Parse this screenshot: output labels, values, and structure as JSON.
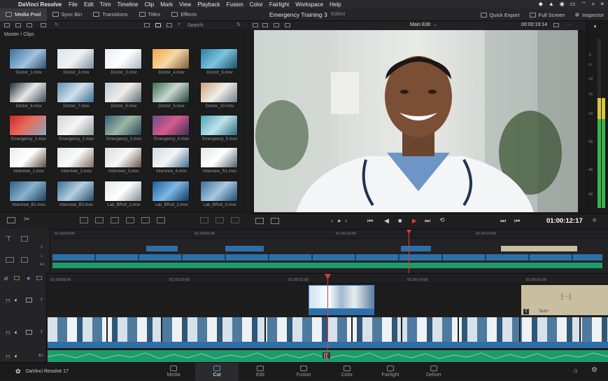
{
  "menubar": {
    "app": "DaVinci Resolve",
    "items": [
      "File",
      "Edit",
      "Trim",
      "Timeline",
      "Clip",
      "Mark",
      "View",
      "Playback",
      "Fusion",
      "Color",
      "Fairlight",
      "Workspace",
      "Help"
    ]
  },
  "toolbar": {
    "media_pool": "Media Pool",
    "sync_bin": "Sync Bin",
    "transitions": "Transitions",
    "titles": "Titles",
    "effects": "Effects",
    "project_title": "Emergency Training 3",
    "edited": "Edited",
    "quick_export": "Quick Export",
    "full_screen": "Full Screen",
    "inspector": "Inspector"
  },
  "pool": {
    "search_label": "Search",
    "bin": "Master / Clips",
    "clips": [
      "Doctor_1.mov",
      "Doctor_2.mov",
      "Doctor_3.mov",
      "Doctor_4.mov",
      "Doctor_5.mov",
      "Doctor_6.mov",
      "Doctor_7.mov",
      "Doctor_8.mov",
      "Doctor_9.mov",
      "Doctor_10.mov",
      "Emergency_1.mov",
      "Emergency_2.mov",
      "Emergency_3.mov",
      "Emergency_4.mov",
      "Emergency_5.mov",
      "Interview_1.mov",
      "Interview_2.mov",
      "Interview_3.mov",
      "Interview_4.mov",
      "Interview_R1.mov",
      "Interview_B2.mov",
      "Interview_B3.mov",
      "Lab_BRoll_1.mov",
      "Lab_BRoll_2.mov",
      "Lab_BRoll_3.mov"
    ]
  },
  "viewer": {
    "mode": "Main Edit",
    "source_timecode": "00:00:19:14",
    "timecode": "01:00:12:17"
  },
  "meter": {
    "scale": [
      "0",
      "-5",
      "-10",
      "-15",
      "-20",
      "-30",
      "-40",
      "-50"
    ]
  },
  "upper_timeline": {
    "ruler": [
      "01:00:00:00",
      "01:00:05:00",
      "01:00:10:00",
      "01:00:15:00"
    ],
    "track_labels": [
      "2",
      "1",
      "A1"
    ]
  },
  "lower_timeline": {
    "ruler": [
      "01:00:08:00",
      "01:00:10:00",
      "01:00:12:00",
      "01:00:14:00",
      "01:00:16:00"
    ],
    "track_labels": [
      "2",
      "1",
      "A1"
    ],
    "title_clip": "Text+"
  },
  "footer": {
    "product": "DaVinci Resolve 17",
    "pages": [
      "Media",
      "Cut",
      "Edit",
      "Fusion",
      "Color",
      "Fairlight",
      "Deliver"
    ],
    "active_page": "Cut"
  },
  "colors": {
    "accent": "#4a8fd8",
    "playhead": "#e03a3a",
    "video_clip": "#2e6fa8",
    "audio_clip": "#1f9a6a",
    "title_clip": "#c9bea0"
  }
}
